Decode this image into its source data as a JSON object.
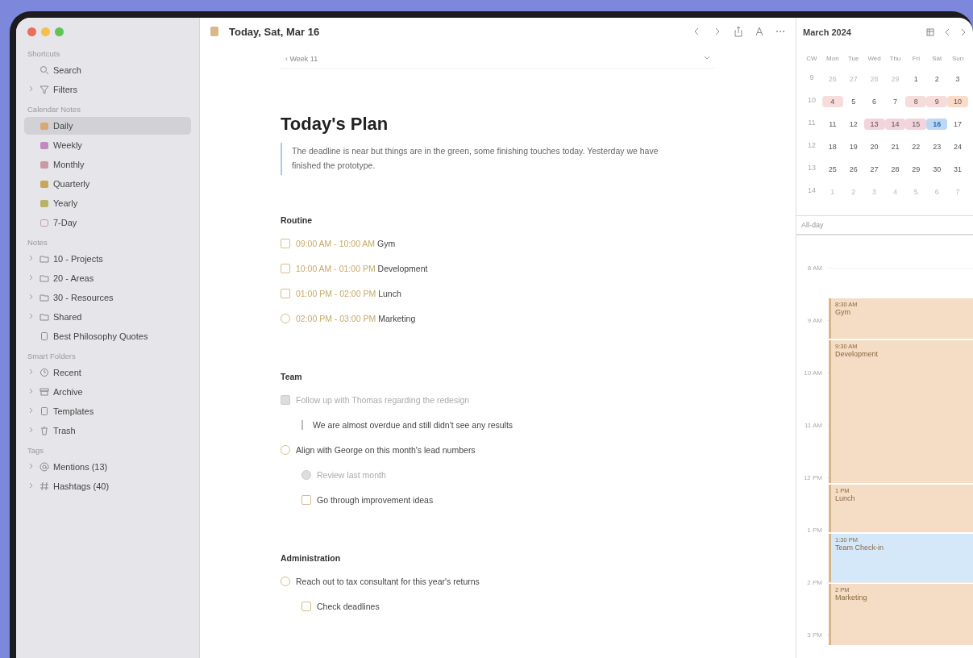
{
  "sidebar": {
    "sections": [
      {
        "heading": "Shortcuts",
        "items": [
          {
            "label": "Search",
            "kind": "search",
            "expandable": false,
            "selected": false
          },
          {
            "label": "Filters",
            "kind": "filter",
            "expandable": true,
            "selected": false
          }
        ]
      },
      {
        "heading": "Calendar Notes",
        "items": [
          {
            "label": "Daily",
            "kind": "cal",
            "expandable": false,
            "selected": true,
            "color": "#d9a877"
          },
          {
            "label": "Weekly",
            "kind": "cal",
            "expandable": false,
            "selected": false,
            "color": "#c28bbd"
          },
          {
            "label": "Monthly",
            "kind": "cal",
            "expandable": false,
            "selected": false,
            "color": "#c99aa6"
          },
          {
            "label": "Quarterly",
            "kind": "cal",
            "expandable": false,
            "selected": false,
            "color": "#c9a65a"
          },
          {
            "label": "Yearly",
            "kind": "cal",
            "expandable": false,
            "selected": false,
            "color": "#b9b36a"
          },
          {
            "label": "7-Day",
            "kind": "week",
            "expandable": false,
            "selected": false,
            "color": "#c79aa0"
          }
        ]
      },
      {
        "heading": "Notes",
        "items": [
          {
            "label": "10 - Projects",
            "kind": "folder",
            "expandable": true,
            "selected": false
          },
          {
            "label": "20 - Areas",
            "kind": "folder",
            "expandable": true,
            "selected": false
          },
          {
            "label": "30 - Resources",
            "kind": "folder",
            "expandable": true,
            "selected": false
          },
          {
            "label": "Shared",
            "kind": "folder",
            "expandable": true,
            "selected": false
          },
          {
            "label": "Best Philosophy Quotes",
            "kind": "note",
            "expandable": false,
            "selected": false
          }
        ]
      },
      {
        "heading": "Smart Folders",
        "items": [
          {
            "label": "Recent",
            "kind": "clock",
            "expandable": true,
            "selected": false
          },
          {
            "label": "Archive",
            "kind": "archive",
            "expandable": true,
            "selected": false
          },
          {
            "label": "Templates",
            "kind": "note",
            "expandable": true,
            "selected": false
          },
          {
            "label": "Trash",
            "kind": "trash",
            "expandable": true,
            "selected": false
          }
        ]
      },
      {
        "heading": "Tags",
        "items": [
          {
            "label": "Mentions (13)",
            "kind": "at",
            "expandable": true,
            "selected": false
          },
          {
            "label": "Hashtags (40)",
            "kind": "hash",
            "expandable": true,
            "selected": false
          }
        ]
      }
    ]
  },
  "editor": {
    "title": "Today, Sat, Mar 16",
    "week_link": "‹ Week 11",
    "heading": "Today's Plan",
    "quote": "The deadline is near but things are in the green, some finishing touches today. Yesterday we have finished the prototype.",
    "sections": [
      {
        "heading": "Routine",
        "items": [
          {
            "kind": "checklist",
            "time": "09:00 AM - 10:00 AM",
            "text": "Gym",
            "checked": false,
            "indented": false
          },
          {
            "kind": "checklist",
            "time": "10:00 AM - 01:00 PM",
            "text": "Development",
            "checked": false,
            "indented": false
          },
          {
            "kind": "checklist",
            "time": "01:00 PM - 02:00 PM",
            "text": "Lunch",
            "checked": false,
            "indented": false
          },
          {
            "kind": "task",
            "time": "02:00 PM - 03:00 PM",
            "text": "Marketing",
            "checked": false,
            "indented": false
          }
        ]
      },
      {
        "heading": "Team",
        "items": [
          {
            "kind": "checklist",
            "text": "Follow up with Thomas regarding the redesign",
            "checked": true,
            "indented": false
          },
          {
            "kind": "quote",
            "text": "We are almost overdue and still didn't see any results",
            "indented": true
          },
          {
            "kind": "task",
            "text": "Align with George on this month's lead numbers",
            "checked": false,
            "indented": false
          },
          {
            "kind": "task",
            "text": "Review last month",
            "checked": true,
            "indented": true
          },
          {
            "kind": "checklist",
            "text": "Go through improvement ideas",
            "checked": false,
            "indented": true
          }
        ]
      },
      {
        "heading": "Administration",
        "items": [
          {
            "kind": "task",
            "text": "Reach out to tax consultant for this year's returns",
            "checked": false,
            "indented": false
          },
          {
            "kind": "checklist",
            "text": "Check deadlines",
            "checked": false,
            "indented": true
          }
        ]
      }
    ]
  },
  "calendar": {
    "month": "March 2024",
    "weekdays": [
      "CW",
      "Mon",
      "Tue",
      "Wed",
      "Thu",
      "Fri",
      "Sat",
      "Sun"
    ],
    "weeks": [
      {
        "cw": "9",
        "days": [
          {
            "d": "26",
            "muted": true,
            "selected": false
          },
          {
            "d": "27",
            "muted": true,
            "selected": false
          },
          {
            "d": "28",
            "muted": true,
            "selected": false
          },
          {
            "d": "29",
            "muted": true,
            "selected": false
          },
          {
            "d": "1",
            "muted": false,
            "selected": false
          },
          {
            "d": "2",
            "muted": false,
            "selected": false
          },
          {
            "d": "3",
            "muted": false,
            "selected": false
          }
        ]
      },
      {
        "cw": "10",
        "days": [
          {
            "d": "4",
            "muted": false,
            "selected": false,
            "color": "#f7dcdc"
          },
          {
            "d": "5",
            "muted": false,
            "selected": false
          },
          {
            "d": "6",
            "muted": false,
            "selected": false
          },
          {
            "d": "7",
            "muted": false,
            "selected": false
          },
          {
            "d": "8",
            "muted": false,
            "selected": false,
            "color": "#f7dcdc"
          },
          {
            "d": "9",
            "muted": false,
            "selected": false,
            "color": "#f7dcdc"
          },
          {
            "d": "10",
            "muted": false,
            "selected": false,
            "color": "#f9dcc8"
          }
        ]
      },
      {
        "cw": "11",
        "days": [
          {
            "d": "11",
            "muted": false,
            "selected": false
          },
          {
            "d": "12",
            "muted": false,
            "selected": false
          },
          {
            "d": "13",
            "muted": false,
            "selected": false,
            "color": "#f4d4dc"
          },
          {
            "d": "14",
            "muted": false,
            "selected": false,
            "color": "#f4d4dc"
          },
          {
            "d": "15",
            "muted": false,
            "selected": false,
            "color": "#f4d4dc"
          },
          {
            "d": "16",
            "muted": false,
            "selected": true
          },
          {
            "d": "17",
            "muted": false,
            "selected": false
          }
        ]
      },
      {
        "cw": "12",
        "days": [
          {
            "d": "18",
            "muted": false,
            "selected": false
          },
          {
            "d": "19",
            "muted": false,
            "selected": false
          },
          {
            "d": "20",
            "muted": false,
            "selected": false
          },
          {
            "d": "21",
            "muted": false,
            "selected": false
          },
          {
            "d": "22",
            "muted": false,
            "selected": false
          },
          {
            "d": "23",
            "muted": false,
            "selected": false
          },
          {
            "d": "24",
            "muted": false,
            "selected": false
          }
        ]
      },
      {
        "cw": "13",
        "days": [
          {
            "d": "25",
            "muted": false,
            "selected": false
          },
          {
            "d": "26",
            "muted": false,
            "selected": false
          },
          {
            "d": "27",
            "muted": false,
            "selected": false
          },
          {
            "d": "28",
            "muted": false,
            "selected": false
          },
          {
            "d": "29",
            "muted": false,
            "selected": false
          },
          {
            "d": "30",
            "muted": false,
            "selected": false
          },
          {
            "d": "31",
            "muted": false,
            "selected": false
          }
        ]
      },
      {
        "cw": "14",
        "days": [
          {
            "d": "1",
            "muted": true,
            "selected": false
          },
          {
            "d": "2",
            "muted": true,
            "selected": false
          },
          {
            "d": "3",
            "muted": true,
            "selected": false
          },
          {
            "d": "4",
            "muted": true,
            "selected": false
          },
          {
            "d": "5",
            "muted": true,
            "selected": false
          },
          {
            "d": "6",
            "muted": true,
            "selected": false
          },
          {
            "d": "7",
            "muted": true,
            "selected": false
          }
        ]
      }
    ],
    "all_day": "All-day",
    "hours": [
      "8 AM",
      "9 AM",
      "10 AM",
      "11 AM",
      "12 PM",
      "1 PM",
      "2 PM",
      "3 PM"
    ],
    "events": [
      {
        "time": "8:30 AM",
        "title": "Gym",
        "color": "#f5dcc4"
      },
      {
        "time": "9:30 AM",
        "title": "Development",
        "color": "#f5dcc4"
      },
      {
        "time": "1 PM",
        "title": "Lunch",
        "color": "#f5dcc4"
      },
      {
        "time": "1:30 PM",
        "title": "Team Check-in",
        "color": "#d4e8fa"
      },
      {
        "time": "2 PM",
        "title": "Marketing",
        "color": "#f5dcc4"
      }
    ]
  }
}
